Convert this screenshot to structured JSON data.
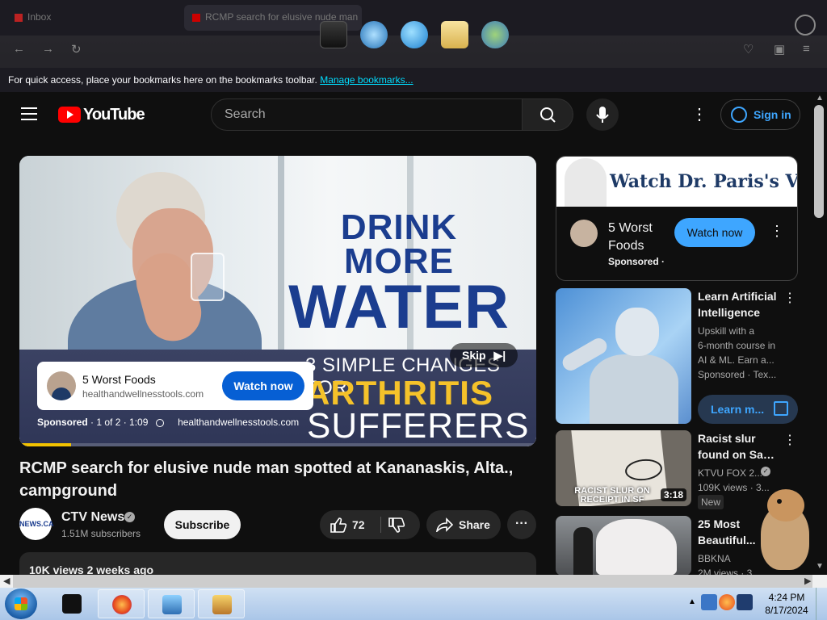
{
  "browser": {
    "tabs": [
      {
        "label": "Inbox"
      },
      {
        "label": "RCMP search for elusive nude man"
      }
    ],
    "bookmarks_bar": {
      "message": "For quick access, place your bookmarks here on the bookmarks toolbar.",
      "link": "Manage bookmarks..."
    },
    "dock_icons": [
      "terminal-icon",
      "globe-download-icon",
      "internet-explorer-icon",
      "mail-folder-icon",
      "users-icon"
    ]
  },
  "youtube": {
    "logo_text": "YouTube",
    "search_placeholder": "Search",
    "sign_in": "Sign in"
  },
  "player": {
    "headline_line1": "DRINK",
    "headline_line2": "MORE",
    "headline_line3": "WATER",
    "banner_sub": "3 SIMPLE CHANGES FOR",
    "banner_big1": "ARTHRITIS",
    "banner_big2": "SUFFERERS",
    "skip_label": "Skip",
    "ad_card": {
      "title": "5 Worst Foods",
      "url": "healthandwellnesstools.com",
      "cta": "Watch now"
    },
    "ad_meta": {
      "sponsored": "Sponsored",
      "position": "1 of 2 · 1:09",
      "url": "healthandwellnesstools.com"
    },
    "ad_progress": 0.1
  },
  "video": {
    "title": "RCMP search for elusive nude man spotted at Kananaskis, Alta., campground",
    "channel": "CTV News",
    "channel_avatar_text": "NEWS.CA",
    "subscribers": "1.51M subscribers",
    "subscribe": "Subscribe",
    "likes": "72",
    "share": "Share",
    "more": "···",
    "description_stats": "10K views  2 weeks ago"
  },
  "sidebar": {
    "promo": {
      "banner_text": "Watch Dr. Paris's Video",
      "title": "5 Worst Foods",
      "sponsored": "Sponsored ·",
      "cta": "Watch now"
    },
    "recommendations": [
      {
        "title_line1": "Learn Artificial",
        "title_line2": "Intelligence",
        "desc": [
          "Upskill with a",
          "6-month course in",
          "AI & ML. Earn a..."
        ],
        "meta": "Sponsored · Tex...",
        "cta": "Learn m..."
      },
      {
        "title_line1": "Racist slur",
        "title_line2": "found on San...",
        "channel": "KTVU FOX 2...",
        "meta": "109K views  · 3...",
        "badge": "New",
        "thumb_caption": "RACIST SLUR ON RECEIPT IN SF",
        "duration": "3:18"
      },
      {
        "title_line1": "25 Most",
        "title_line2": "Beautiful...",
        "channel": "BBKNA",
        "meta": "2M views  · 3..."
      }
    ]
  },
  "taskbar": {
    "items": [
      "terminal-icon",
      "firefox-icon",
      "network-computer-icon",
      "game-box-icon"
    ],
    "time": "4:24 PM",
    "date": "8/17/2024"
  }
}
